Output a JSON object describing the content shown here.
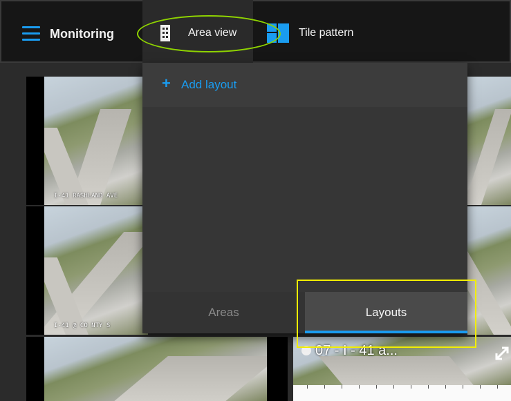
{
  "header": {
    "title": "Monitoring",
    "tabs": [
      {
        "label": "Area view",
        "icon": "building-icon",
        "active": true
      },
      {
        "label": "Tile pattern",
        "icon": "tile-pattern-icon",
        "active": false
      }
    ]
  },
  "dropdown": {
    "add_layout_label": "Add layout",
    "sub_tabs": [
      {
        "label": "Areas",
        "active": false
      },
      {
        "label": "Layouts",
        "active": true
      }
    ]
  },
  "cameras": [
    {
      "stamp": "I-41 RASHLAND AVE"
    },
    {
      "stamp": "I-41 @ CO NTY S"
    },
    {
      "stamp": ""
    },
    {
      "stamp": ""
    },
    {
      "stamp": ""
    },
    {
      "label": "07 - I - 41 a..."
    }
  ],
  "colors": {
    "accent": "#1a9cf0",
    "annotation_green": "#8fd400",
    "annotation_yellow": "#f2ee00"
  }
}
